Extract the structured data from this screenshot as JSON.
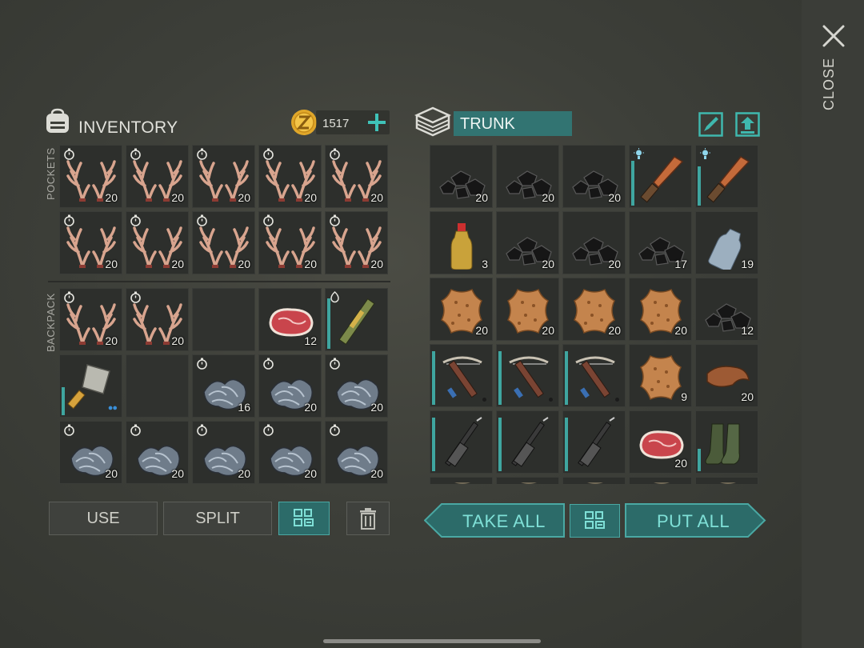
{
  "close": {
    "label": "CLOSE"
  },
  "inventory": {
    "title": "INVENTORY",
    "coins": "1517",
    "pockets_label": "POCKETS",
    "backpack_label": "BACKPACK",
    "pockets": [
      {
        "item": "antlers",
        "count": "20",
        "timer": true
      },
      {
        "item": "antlers",
        "count": "20",
        "timer": true
      },
      {
        "item": "antlers",
        "count": "20",
        "timer": true
      },
      {
        "item": "antlers",
        "count": "20",
        "timer": true
      },
      {
        "item": "antlers",
        "count": "20",
        "timer": true
      },
      {
        "item": "antlers",
        "count": "20",
        "timer": true
      },
      {
        "item": "antlers",
        "count": "20",
        "timer": true
      },
      {
        "item": "antlers",
        "count": "20",
        "timer": true
      },
      {
        "item": "antlers",
        "count": "20",
        "timer": true
      },
      {
        "item": "antlers",
        "count": "20",
        "timer": true
      }
    ],
    "backpack": [
      {
        "item": "antlers",
        "count": "20",
        "timer": true
      },
      {
        "item": "antlers",
        "count": "20",
        "timer": true
      },
      {
        "item": "empty"
      },
      {
        "item": "raw-meat",
        "count": "12"
      },
      {
        "item": "rifle-weapon",
        "bar": 0.9,
        "badge": "durability"
      },
      {
        "item": "cleaver",
        "bar": 0.5,
        "dots": "●●"
      },
      {
        "item": "empty"
      },
      {
        "item": "wool",
        "count": "16",
        "timer": true
      },
      {
        "item": "wool",
        "count": "20",
        "timer": true
      },
      {
        "item": "wool",
        "count": "20",
        "timer": true
      },
      {
        "item": "wool",
        "count": "20",
        "timer": true
      },
      {
        "item": "wool",
        "count": "20",
        "timer": true
      },
      {
        "item": "wool",
        "count": "20",
        "timer": true
      },
      {
        "item": "wool",
        "count": "20",
        "timer": true
      },
      {
        "item": "wool",
        "count": "20",
        "timer": true
      }
    ],
    "buttons": {
      "use": "USE",
      "split": "SPLIT"
    }
  },
  "trunk": {
    "title": "TRUNK",
    "items": [
      {
        "item": "coal",
        "count": "20"
      },
      {
        "item": "coal",
        "count": "20"
      },
      {
        "item": "coal",
        "count": "20"
      },
      {
        "item": "knife",
        "bar": 0.8,
        "badge": "light"
      },
      {
        "item": "knife",
        "bar": 0.7,
        "badge": "light"
      },
      {
        "item": "oil-bottle",
        "count": "3"
      },
      {
        "item": "coal",
        "count": "20"
      },
      {
        "item": "coal",
        "count": "20"
      },
      {
        "item": "coal",
        "count": "17"
      },
      {
        "item": "water-bottle",
        "count": "19"
      },
      {
        "item": "hide",
        "count": "20"
      },
      {
        "item": "hide",
        "count": "20"
      },
      {
        "item": "hide",
        "count": "20"
      },
      {
        "item": "hide",
        "count": "20"
      },
      {
        "item": "coal",
        "count": "12"
      },
      {
        "item": "crossbow",
        "bar": 0.95,
        "dot": true
      },
      {
        "item": "crossbow",
        "bar": 0.95,
        "dot": true
      },
      {
        "item": "crossbow",
        "bar": 0.95,
        "dot": true
      },
      {
        "item": "hide",
        "count": "9"
      },
      {
        "item": "leather",
        "count": "20"
      },
      {
        "item": "rifle",
        "bar": 0.95
      },
      {
        "item": "rifle",
        "bar": 0.95
      },
      {
        "item": "rifle",
        "bar": 0.95
      },
      {
        "item": "raw-meat",
        "count": "20"
      },
      {
        "item": "boots",
        "bar": 0.4
      },
      {
        "item": "partial"
      },
      {
        "item": "partial"
      },
      {
        "item": "partial"
      },
      {
        "item": "partial"
      },
      {
        "item": "partial"
      }
    ],
    "buttons": {
      "take_all": "TAKE ALL",
      "put_all": "PUT ALL"
    }
  },
  "colors": {
    "teal": "#327472",
    "accent": "#4aa8a3",
    "text": "#e2e2dc"
  }
}
